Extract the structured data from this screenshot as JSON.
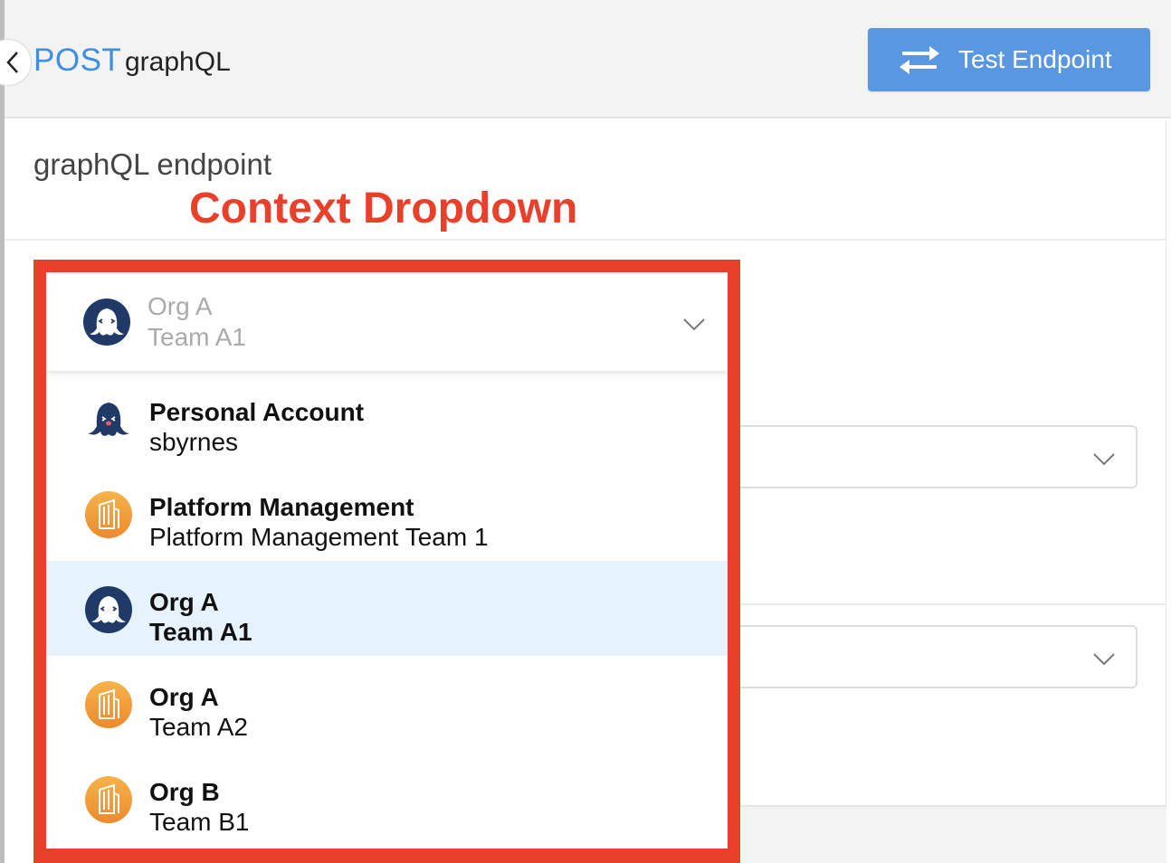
{
  "header": {
    "method": "POST",
    "endpoint_name": "graphQL",
    "back_icon": "chevron-left-icon",
    "test_button_label": "Test Endpoint",
    "test_button_icon": "swap-arrows-icon",
    "test_button_color": "#5a97e3"
  },
  "section": {
    "title": "graphQL endpoint"
  },
  "annotation": {
    "text": "Context Dropdown",
    "color": "#e8402b"
  },
  "context_dropdown": {
    "selected": {
      "org": "Org A",
      "team": "Team A1",
      "icon": "octopus-avatar-icon"
    },
    "options": [
      {
        "org": "Personal Account",
        "team": "sbyrnes",
        "icon": "octopus-avatar-icon",
        "selected": false
      },
      {
        "org": "Platform Management",
        "team": "Platform Management Team 1",
        "icon": "building-avatar-icon",
        "selected": false
      },
      {
        "org": "Org A",
        "team": "Team A1",
        "icon": "octopus-avatar-icon",
        "selected": true
      },
      {
        "org": "Org A",
        "team": "Team A2",
        "icon": "building-avatar-icon",
        "selected": false
      },
      {
        "org": "Org B",
        "team": "Team B1",
        "icon": "building-avatar-icon",
        "selected": false
      }
    ],
    "selected_bg": "#e6f2fc"
  }
}
